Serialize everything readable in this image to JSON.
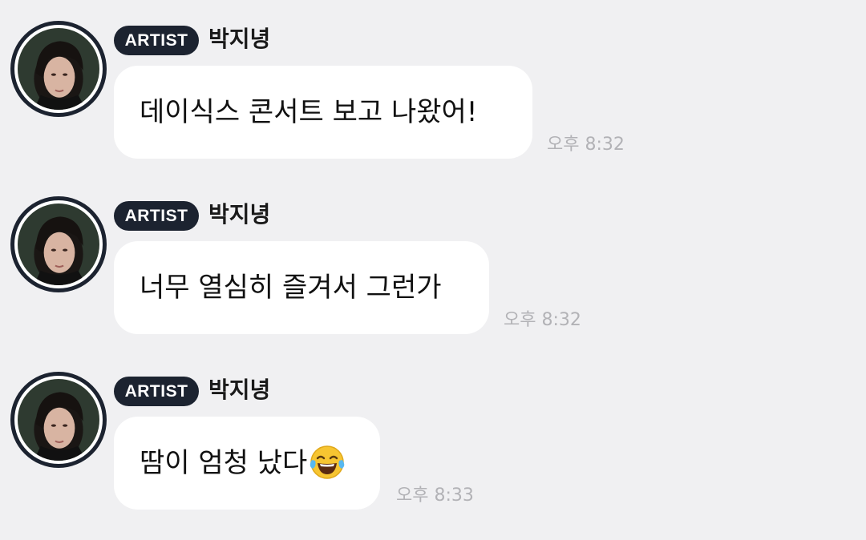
{
  "messages": [
    {
      "badge": "ARTIST",
      "sender": "박지녕",
      "text": "데이식스 콘서트 보고 나왔어!",
      "time": "오후 8:32"
    },
    {
      "badge": "ARTIST",
      "sender": "박지녕",
      "text": "너무 열심히 즐겨서 그런가",
      "time": "오후 8:32"
    },
    {
      "badge": "ARTIST",
      "sender": "박지녕",
      "text": "땀이 엄청 났다",
      "emoji": "face-with-tears-of-joy",
      "time": "오후 8:33"
    }
  ],
  "colors": {
    "background": "#f0f0f2",
    "badge": "#1c2330",
    "bubble": "#ffffff",
    "time": "#b2b2b6"
  }
}
